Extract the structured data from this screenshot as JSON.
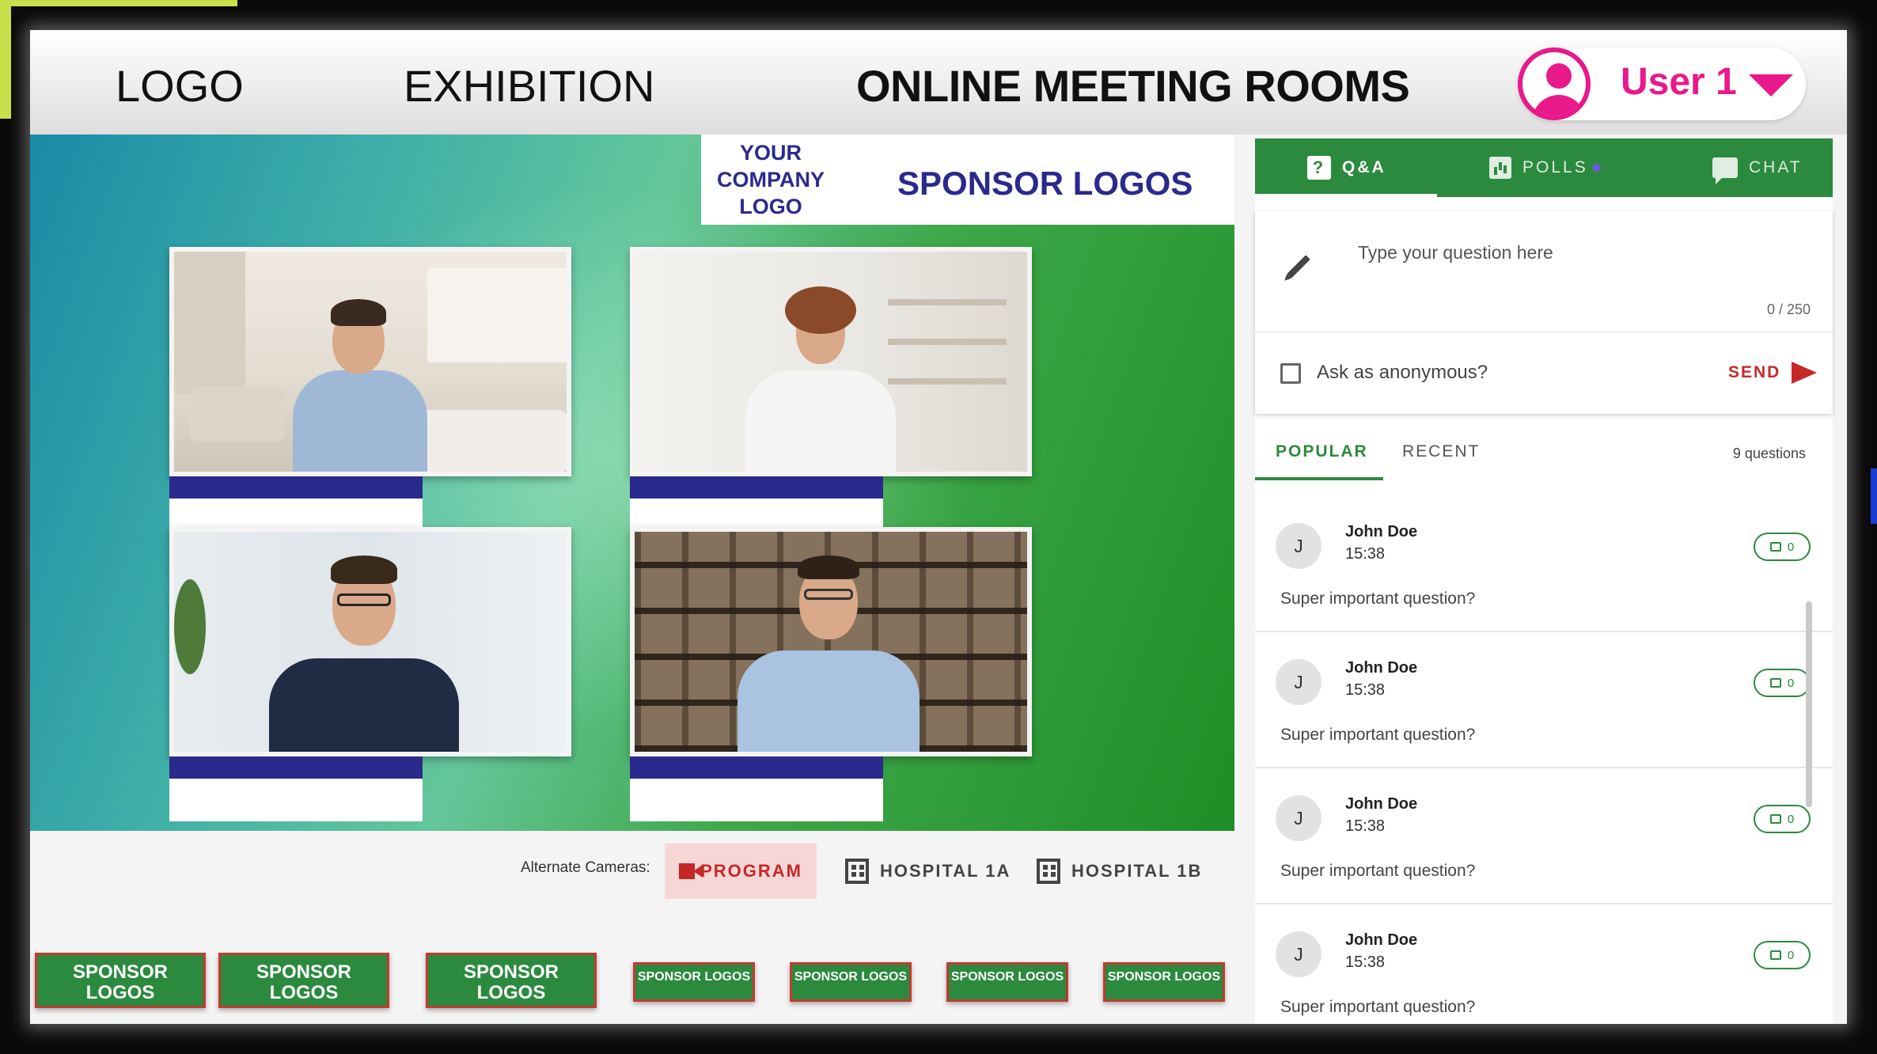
{
  "header": {
    "logo": "LOGO",
    "exhibition": "EXHIBITION",
    "rooms": "ONLINE MEETING ROOMS",
    "user_name": "User 1"
  },
  "stage": {
    "company_logo": "YOUR COMPANY LOGO",
    "sponsor_logos": "SPONSOR LOGOS"
  },
  "cameras": {
    "label": "Alternate Cameras:",
    "options": [
      "PROGRAM",
      "HOSPITAL 1A",
      "HOSPITAL 1B"
    ],
    "active": "PROGRAM"
  },
  "sponsor_tiles": [
    "SPONSOR LOGOS",
    "SPONSOR LOGOS",
    "SPONSOR LOGOS",
    "SPONSOR LOGOS",
    "SPONSOR LOGOS",
    "SPONSOR LOGOS",
    "SPONSOR LOGOS"
  ],
  "panel": {
    "tabs": [
      "Q&A",
      "POLLS",
      "CHAT"
    ],
    "question_placeholder": "Type your question here",
    "char_count": "0 / 250",
    "anonymous_label": "Ask as anonymous?",
    "send_label": "SEND",
    "sort_tabs": [
      "POPULAR",
      "RECENT"
    ],
    "question_count": "9 questions",
    "questions": [
      {
        "initial": "J",
        "name": "John Doe",
        "time": "15:38",
        "text": "Super important question?",
        "likes": "0"
      },
      {
        "initial": "J",
        "name": "John Doe",
        "time": "15:38",
        "text": "Super important question?",
        "likes": "0"
      },
      {
        "initial": "J",
        "name": "John Doe",
        "time": "15:38",
        "text": "Super important question?",
        "likes": "0"
      },
      {
        "initial": "J",
        "name": "John Doe",
        "time": "15:38",
        "text": "Super important question?",
        "likes": "0"
      }
    ]
  },
  "colors": {
    "accent_green": "#2b8a3e",
    "user_pink": "#e8198a",
    "navy": "#2a2a8c",
    "alert_red": "#c62828"
  }
}
